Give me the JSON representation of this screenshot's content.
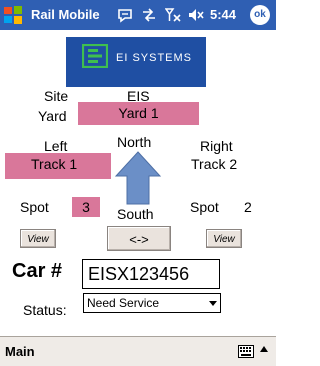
{
  "titlebar": {
    "app_title": "Rail Mobile",
    "time": "5:44",
    "ok_label": "ok"
  },
  "brand": {
    "name": "EI SYSTEMS"
  },
  "site": {
    "label": "Site",
    "value": "EIS"
  },
  "yard": {
    "label": "Yard",
    "value": "Yard 1"
  },
  "left": {
    "label": "Left",
    "value": "Track 1"
  },
  "right": {
    "label": "Right",
    "value": "Track 2"
  },
  "direction": {
    "north": "North",
    "south": "South"
  },
  "spot_left": {
    "label": "Spot",
    "value": "3"
  },
  "spot_right": {
    "label": "Spot",
    "value": "2"
  },
  "buttons": {
    "view_left": "View",
    "swap": "<->",
    "view_right": "View"
  },
  "car": {
    "label": "Car #",
    "value": "EISX123456"
  },
  "status": {
    "label": "Status:",
    "value": "Need Service"
  },
  "menubar": {
    "main_label": "Main"
  },
  "colors": {
    "titlebar": "#2f5fb3",
    "highlight": "#d9779a",
    "arrow": "#6b8fc7",
    "brand": "#1f4fa3"
  }
}
